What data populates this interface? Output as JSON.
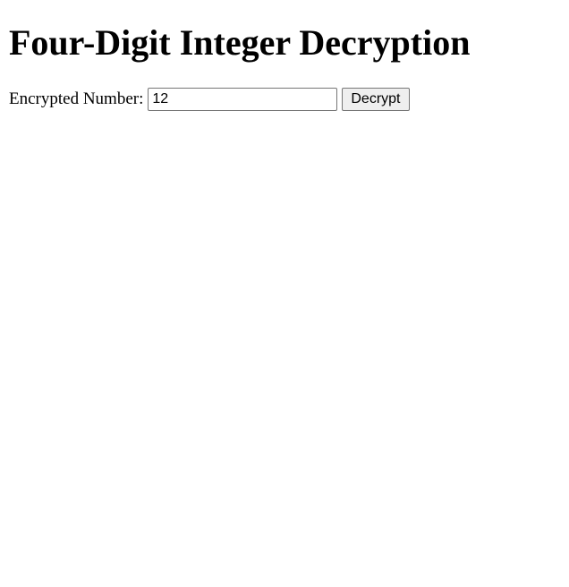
{
  "page": {
    "title": "Four-Digit Integer Decryption"
  },
  "form": {
    "label": "Encrypted Number:",
    "input_value": "12",
    "decrypt_label": "Decrypt"
  }
}
